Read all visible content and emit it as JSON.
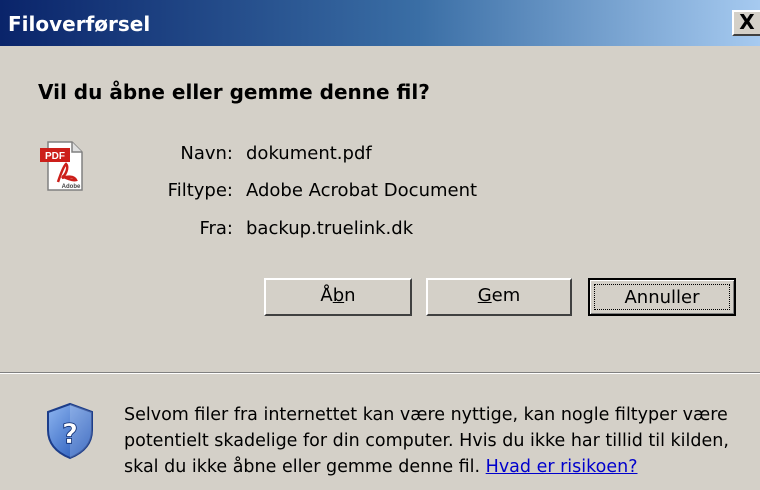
{
  "window": {
    "title": "Filoverførsel",
    "close_label": "X"
  },
  "dialog": {
    "question": "Vil du åbne eller gemme denne fil?",
    "file_icon_label": "PDF",
    "file_icon_sublabel": "Adobe",
    "fields": [
      {
        "label": "Navn:",
        "value": "dokument.pdf"
      },
      {
        "label": "Filtype:",
        "value": "Adobe Acrobat Document"
      },
      {
        "label": "Fra:",
        "value": "backup.truelink.dk"
      }
    ]
  },
  "buttons": {
    "open": {
      "label_pre": "Å",
      "label_acc": "b",
      "label_post": "n"
    },
    "save": {
      "label_pre": "",
      "label_acc": "G",
      "label_post": "em"
    },
    "cancel": {
      "label": "Annuller"
    }
  },
  "warning": {
    "text": "Selvom filer fra internettet kan være nyttige, kan nogle filtyper være potentielt skadelige for din computer. Hvis du ikke har tillid til kilden, skal du ikke åbne eller gemme denne fil. ",
    "link": "Hvad er risikoen?"
  },
  "colors": {
    "dialog_bg": "#d4d0c8",
    "titlebar_start": "#0a246a",
    "titlebar_end": "#a6caf0",
    "link": "#0000cc",
    "pdf_red": "#cc1f1a"
  },
  "icons": [
    "pdf-file-icon",
    "security-shield-question-icon",
    "close-icon"
  ]
}
